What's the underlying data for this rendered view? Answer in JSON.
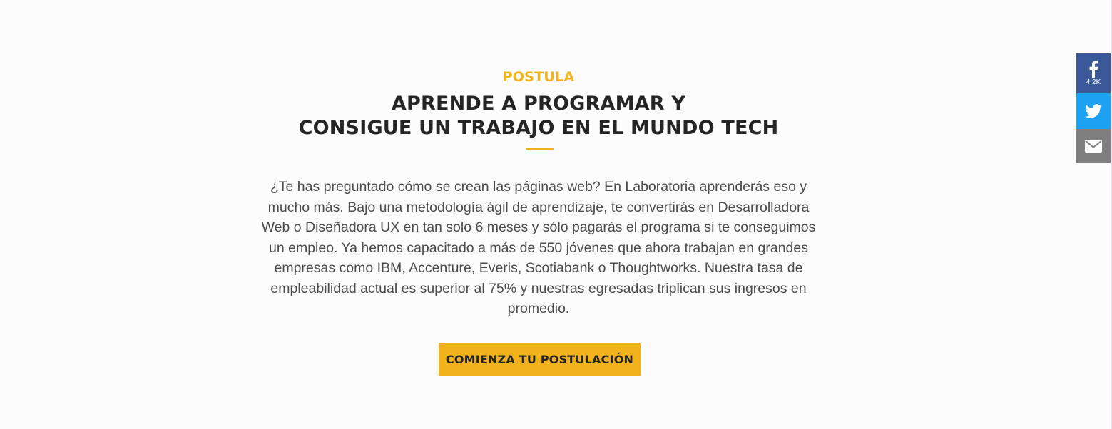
{
  "section": {
    "eyebrow": "POSTULA",
    "title_line1": "APRENDE A PROGRAMAR Y",
    "title_line2": "CONSIGUE UN TRABAJO EN EL MUNDO TECH",
    "description": "¿Te has preguntado cómo se crean las páginas web? En Laboratoria aprenderás eso y mucho más. Bajo una metodología ágil de aprendizaje, te convertirás en Desarrolladora Web o Diseñadora UX en tan solo 6 meses y sólo pagarás el programa si te conseguimos un empleo. Ya hemos capacitado a más de 550 jóvenes que ahora trabajan en grandes empresas como IBM, Accenture, Everis, Scotiabank o Thoughtworks. Nuestra tasa de empleabilidad actual es superior al 75% y nuestras egresadas triplican sus ingresos en promedio.",
    "cta_label": "COMIENZA TU POSTULACIÓN"
  },
  "share": {
    "facebook_icon": "facebook-icon",
    "facebook_count": "4.2K",
    "twitter_icon": "twitter-icon",
    "email_icon": "envelope-icon"
  },
  "colors": {
    "accent": "#f2b21b",
    "heading": "#262526",
    "body_text": "#4a494b",
    "facebook": "#3b5998",
    "twitter": "#1da1f2",
    "email": "#7f7f7f"
  }
}
